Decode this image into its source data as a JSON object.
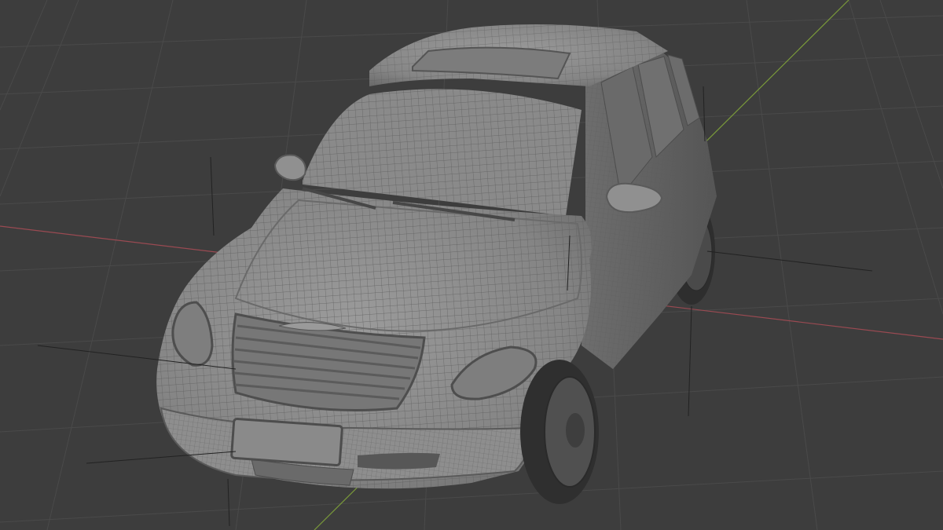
{
  "viewport": {
    "background_color": "#3d3d3d",
    "grid_color": "#4a4a4a",
    "x_axis_color": "#9a4a52",
    "y_axis_color": "#7a9a3a",
    "model_shading": "wireframe-on-solid",
    "model_color": "#8c8c8c",
    "wire_color": "#5f5f5f"
  },
  "model": {
    "subject": "car-model",
    "parts": [
      "roof",
      "sunroof",
      "windshield",
      "hood",
      "grille",
      "front-bumper",
      "license-plate",
      "headlight-left",
      "headlight-right",
      "mirror-left",
      "mirror-right",
      "wiper-left",
      "wiper-right",
      "front-wheel",
      "rear-wheel",
      "side-windows"
    ]
  }
}
